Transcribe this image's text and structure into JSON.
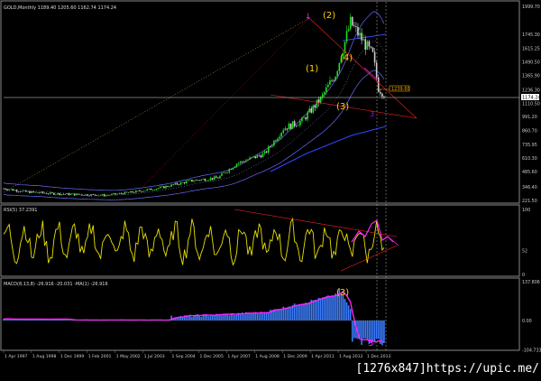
{
  "header": {
    "price_title": "GOLD,Monthly  1189.40 1205.60 1162.74 1174.24",
    "rsi_title": "RSI(5) 37.2391",
    "macd_title": "MACD(8,13,8) -26.916 -20.031 -MA(1) -26.916"
  },
  "price_axis": [
    "1999.70",
    "1745.30",
    "1615.25",
    "1490.50",
    "1365.90",
    "1236.30",
    "1110.50",
    "991.20",
    "860.70",
    "735.95",
    "610.30",
    "485.60",
    "346.40",
    "221.50"
  ],
  "price_badges": {
    "current": "1174.24",
    "level": "1239.60"
  },
  "rsi_axis": [
    "100",
    "52",
    "0"
  ],
  "macd_axis": [
    "137.806",
    "0.00",
    "-104.733"
  ],
  "time_axis": [
    "1 Apr 1997",
    "1 Aug 1998",
    "1 Dec 1999",
    "1 Feb 2001",
    "1 May 2002",
    "1 Jul 2003",
    "1 Sep 2004",
    "1 Dec 2005",
    "1 Apr 2007",
    "1 Aug 2008",
    "1 Dec 2009",
    "1 Apr 2011",
    "1 Aug 2012",
    "1 Dec 2013"
  ],
  "waves": {
    "w1": "(1)",
    "w2": "(2)",
    "w3": "(3)",
    "w4": "(4)",
    "macd_w3": "(3)",
    "red3": "3",
    "macd3": "3"
  },
  "footer": {
    "tag": "[1276x847]https://upic.me/"
  },
  "colors": {
    "candle_up": "#22dd22",
    "candle_down": "#cccccc",
    "rsi": "#e8e000",
    "macd_hist": "#3a7dff",
    "macd_signal": "#ff22ff",
    "trend": "#ff2222",
    "wave_label": "#ffd400",
    "bands": "#6a6aff"
  },
  "chart_data": [
    {
      "type": "line",
      "title": "GOLD,Monthly  1189.40 1205.60 1162.74 1174.24",
      "x": [
        "1997",
        "1998",
        "1999",
        "2000",
        "2001",
        "2002",
        "2003",
        "2004",
        "2005",
        "2006",
        "2007",
        "2008",
        "2009",
        "2010",
        "2011",
        "2012",
        "2013",
        "2014"
      ],
      "series": [
        {
          "values": [
            340,
            295,
            285,
            280,
            265,
            310,
            360,
            420,
            450,
            600,
            680,
            900,
            1000,
            1300,
            1850,
            1700,
            1300,
            1190
          ]
        }
      ],
      "ylim": [
        221.5,
        1999.7
      ]
    },
    {
      "type": "line",
      "title": "RSI(5) 37.2391",
      "ylim": [
        0,
        100
      ]
    },
    {
      "type": "bar",
      "title": "MACD(8,13,8) -26.916 -20.031 -MA(1) -26.916",
      "ylim": [
        -104.733,
        137.806
      ]
    }
  ]
}
